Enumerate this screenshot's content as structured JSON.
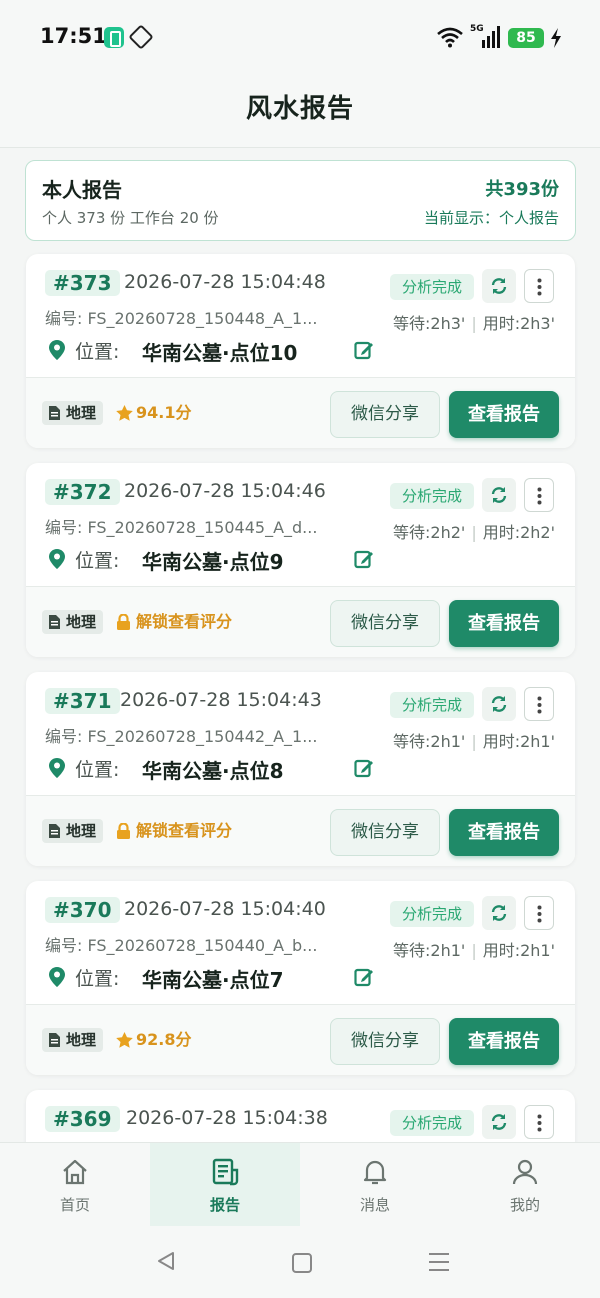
{
  "status_bar": {
    "time": "17:51",
    "network": "5G",
    "battery": "85"
  },
  "header": {
    "title": "风水报告"
  },
  "summary": {
    "title": "本人报告",
    "subtitle": "个人 373 份  工作台 20 份",
    "total": "共393份",
    "current_display": "当前显示：个人报告"
  },
  "cards": [
    {
      "id": "#373",
      "date": "2026-07-28 15:04:48",
      "code": "编号: FS_20260728_150448_A_1...",
      "location_label": "位置:",
      "location": "华南公墓·点位10",
      "status": "分析完成",
      "wait": "等待:2h3'",
      "used": "用时:2h3'",
      "tag": "地理",
      "score": "94.1分",
      "locked": false,
      "share_label": "微信分享",
      "view_label": "查看报告"
    },
    {
      "id": "#372",
      "date": "2026-07-28 15:04:46",
      "code": "编号: FS_20260728_150445_A_d...",
      "location_label": "位置:",
      "location": "华南公墓·点位9",
      "status": "分析完成",
      "wait": "等待:2h2'",
      "used": "用时:2h2'",
      "tag": "地理",
      "score": "解锁查看评分",
      "locked": true,
      "share_label": "微信分享",
      "view_label": "查看报告"
    },
    {
      "id": "#371",
      "date": "2026-07-28 15:04:43",
      "code": "编号: FS_20260728_150442_A_1...",
      "location_label": "位置:",
      "location": "华南公墓·点位8",
      "status": "分析完成",
      "wait": "等待:2h1'",
      "used": "用时:2h1'",
      "tag": "地理",
      "score": "解锁查看评分",
      "locked": true,
      "share_label": "微信分享",
      "view_label": "查看报告"
    },
    {
      "id": "#370",
      "date": "2026-07-28 15:04:40",
      "code": "编号: FS_20260728_150440_A_b...",
      "location_label": "位置:",
      "location": "华南公墓·点位7",
      "status": "分析完成",
      "wait": "等待:2h1'",
      "used": "用时:2h1'",
      "tag": "地理",
      "score": "92.8分",
      "locked": false,
      "share_label": "微信分享",
      "view_label": "查看报告"
    },
    {
      "id": "#369",
      "date": "2026-07-28 15:04:38",
      "status": "分析完成"
    }
  ],
  "tabs": [
    {
      "label": "首页",
      "icon": "home-icon",
      "active": false
    },
    {
      "label": "报告",
      "icon": "report-icon",
      "active": true
    },
    {
      "label": "消息",
      "icon": "bell-icon",
      "active": false
    },
    {
      "label": "我的",
      "icon": "user-icon",
      "active": false
    }
  ],
  "colors": {
    "accent": "#1f8a68",
    "accent_light": "#e5f4ed",
    "score": "#d8931d"
  }
}
